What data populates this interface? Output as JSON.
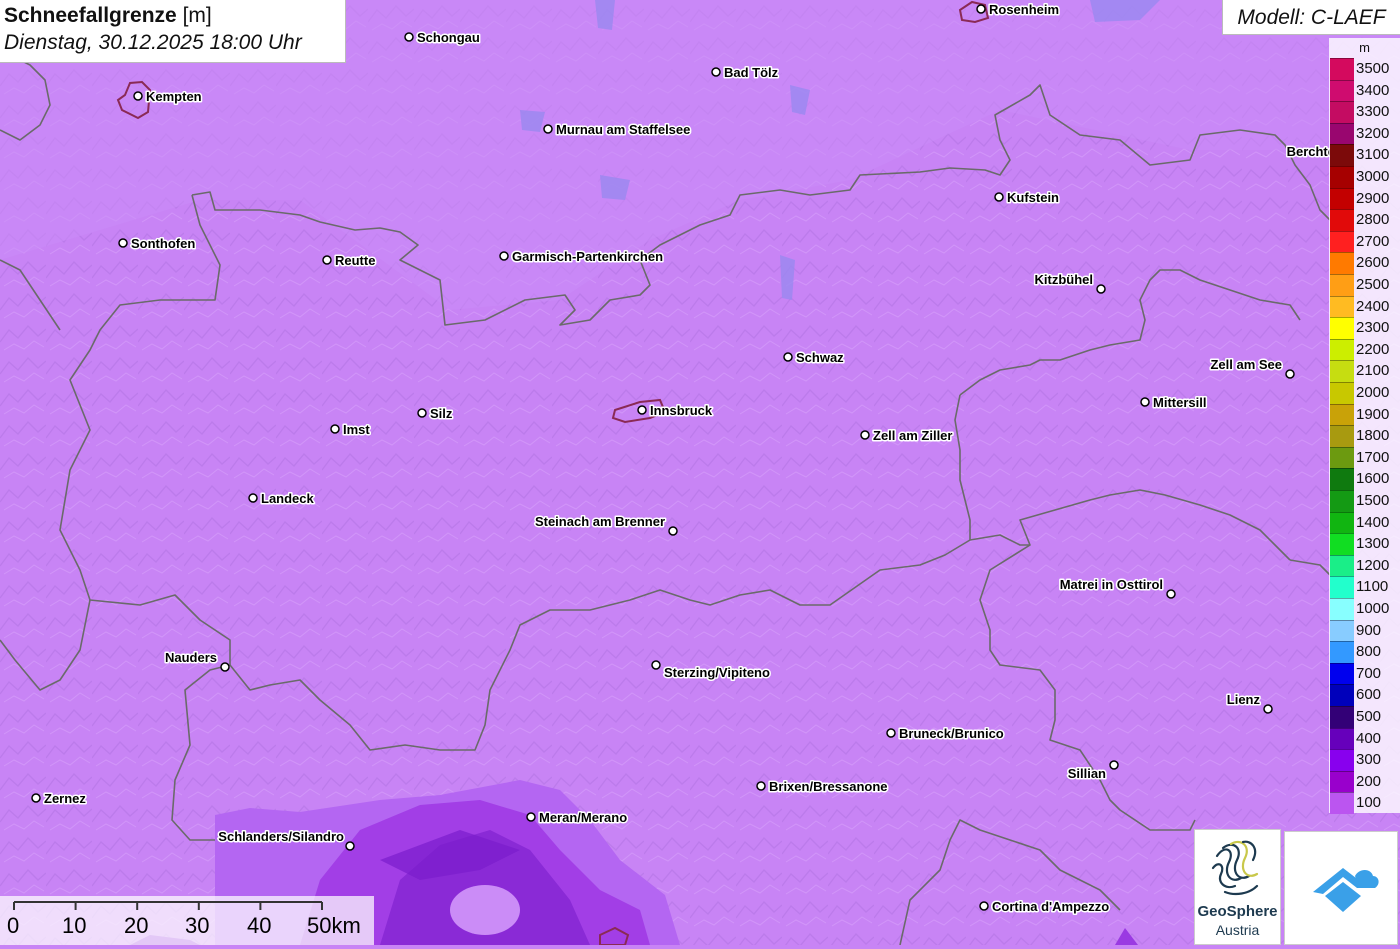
{
  "header": {
    "title_bold": "Schneefallgrenze",
    "title_unit": "[m]",
    "subtitle": "Dienstag, 30.12.2025 18:00 Uhr",
    "model": "Modell: C-LAEF"
  },
  "legend": {
    "unit": "m",
    "entries": [
      {
        "label": "3500",
        "color": "#d40a5e"
      },
      {
        "label": "3400",
        "color": "#cf0c6f"
      },
      {
        "label": "3300",
        "color": "#c40c62"
      },
      {
        "label": "3200",
        "color": "#99066f"
      },
      {
        "label": "3100",
        "color": "#7c0a0a"
      },
      {
        "label": "3000",
        "color": "#a60000"
      },
      {
        "label": "2900",
        "color": "#c30000"
      },
      {
        "label": "2800",
        "color": "#e10a0a"
      },
      {
        "label": "2700",
        "color": "#ff2020"
      },
      {
        "label": "2600",
        "color": "#ff7a00"
      },
      {
        "label": "2500",
        "color": "#ff9e15"
      },
      {
        "label": "2400",
        "color": "#ffbb22"
      },
      {
        "label": "2300",
        "color": "#ffff00"
      },
      {
        "label": "2200",
        "color": "#ccee00"
      },
      {
        "label": "2100",
        "color": "#c6dd11"
      },
      {
        "label": "2000",
        "color": "#c8c800"
      },
      {
        "label": "1900",
        "color": "#c9a208"
      },
      {
        "label": "1800",
        "color": "#a89a10"
      },
      {
        "label": "1700",
        "color": "#6c9a10"
      },
      {
        "label": "1600",
        "color": "#0f7a0f"
      },
      {
        "label": "1500",
        "color": "#149a14"
      },
      {
        "label": "1400",
        "color": "#11b511"
      },
      {
        "label": "1300",
        "color": "#11dd22"
      },
      {
        "label": "1200",
        "color": "#1aee88"
      },
      {
        "label": "1100",
        "color": "#22ffcc"
      },
      {
        "label": "1000",
        "color": "#88ffff"
      },
      {
        "label": "900",
        "color": "#88ccff"
      },
      {
        "label": "800",
        "color": "#3399ff"
      },
      {
        "label": "700",
        "color": "#0000ee"
      },
      {
        "label": "600",
        "color": "#0000bb"
      },
      {
        "label": "500",
        "color": "#330077"
      },
      {
        "label": "400",
        "color": "#6600bb"
      },
      {
        "label": "300",
        "color": "#8800ee"
      },
      {
        "label": "200",
        "color": "#9900cc"
      },
      {
        "label": "100",
        "color": "#bb55f0"
      }
    ]
  },
  "cities": [
    {
      "name": "Rosenheim"
    },
    {
      "name": "Schongau"
    },
    {
      "name": "Bad Tölz"
    },
    {
      "name": "Kempten"
    },
    {
      "name": "Murnau am Staffelsee"
    },
    {
      "name": "Berchte"
    },
    {
      "name": "Kufstein"
    },
    {
      "name": "Sonthofen"
    },
    {
      "name": "Reutte"
    },
    {
      "name": "Garmisch-Partenkirchen"
    },
    {
      "name": "Kitzbühel"
    },
    {
      "name": "Schwaz"
    },
    {
      "name": "Zell am See"
    },
    {
      "name": "Mittersill"
    },
    {
      "name": "Silz"
    },
    {
      "name": "Innsbruck"
    },
    {
      "name": "Imst"
    },
    {
      "name": "Zell am Ziller"
    },
    {
      "name": "Landeck"
    },
    {
      "name": "Steinach am Brenner"
    },
    {
      "name": "Matrei in Osttirol"
    },
    {
      "name": "Nauders"
    },
    {
      "name": "Sterzing/Vipiteno"
    },
    {
      "name": "Lienz"
    },
    {
      "name": "Bruneck/Brunico"
    },
    {
      "name": "Sillian"
    },
    {
      "name": "Brixen/Bressanone"
    },
    {
      "name": "Zernez"
    },
    {
      "name": "Meran/Merano"
    },
    {
      "name": "Schlanders/Silandro"
    },
    {
      "name": "Cortina d'Ampezzo"
    }
  ],
  "scale": {
    "labels": [
      "0",
      "10",
      "20",
      "30",
      "40",
      "50km"
    ]
  },
  "logos": {
    "geosphere_line1": "GeoSphere",
    "geosphere_line2": "Austria"
  },
  "colors": {
    "background": "#c884f5",
    "border": "#6a6a6a",
    "lowband": "#a640e8",
    "lowcore": "#7a1ccc"
  }
}
